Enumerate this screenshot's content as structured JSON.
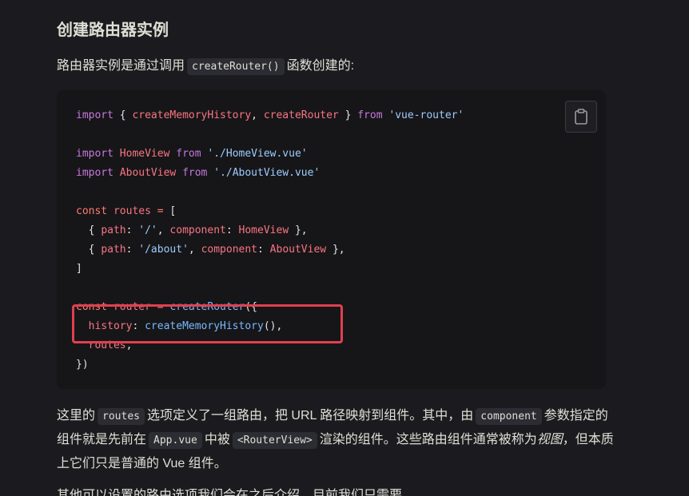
{
  "section": {
    "title": "创建路由器实例"
  },
  "intro": {
    "before": "路由器实例是通过调用",
    "code": "createRouter()",
    "after": "函数创建的:"
  },
  "code_block": {
    "copy_icon": "clipboard-icon",
    "lines": [
      [
        [
          "kw",
          "import"
        ],
        [
          "plain",
          " { "
        ],
        [
          "id",
          "createMemoryHistory"
        ],
        [
          "plain",
          ", "
        ],
        [
          "id",
          "createRouter"
        ],
        [
          "plain",
          " } "
        ],
        [
          "kw",
          "from"
        ],
        [
          "plain",
          " "
        ],
        [
          "str",
          "'vue-router'"
        ]
      ],
      [],
      [
        [
          "kw",
          "import"
        ],
        [
          "plain",
          " "
        ],
        [
          "id",
          "HomeView"
        ],
        [
          "plain",
          " "
        ],
        [
          "kw",
          "from"
        ],
        [
          "plain",
          " "
        ],
        [
          "str",
          "'./HomeView.vue'"
        ]
      ],
      [
        [
          "kw",
          "import"
        ],
        [
          "plain",
          " "
        ],
        [
          "id",
          "AboutView"
        ],
        [
          "plain",
          " "
        ],
        [
          "kw",
          "from"
        ],
        [
          "plain",
          " "
        ],
        [
          "str",
          "'./AboutView.vue'"
        ]
      ],
      [],
      [
        [
          "kw2",
          "const"
        ],
        [
          "plain",
          " "
        ],
        [
          "id",
          "routes"
        ],
        [
          "plain",
          " "
        ],
        [
          "kw2",
          "="
        ],
        [
          "plain",
          " ["
        ]
      ],
      [
        [
          "plain",
          "  { "
        ],
        [
          "id",
          "path"
        ],
        [
          "plain",
          ": "
        ],
        [
          "str",
          "'/'"
        ],
        [
          "plain",
          ", "
        ],
        [
          "id",
          "component"
        ],
        [
          "plain",
          ": "
        ],
        [
          "id",
          "HomeView"
        ],
        [
          "plain",
          " },"
        ]
      ],
      [
        [
          "plain",
          "  { "
        ],
        [
          "id",
          "path"
        ],
        [
          "plain",
          ": "
        ],
        [
          "str",
          "'/about'"
        ],
        [
          "plain",
          ", "
        ],
        [
          "id",
          "component"
        ],
        [
          "plain",
          ": "
        ],
        [
          "id",
          "AboutView"
        ],
        [
          "plain",
          " },"
        ]
      ],
      [
        [
          "plain",
          "]"
        ]
      ],
      [],
      [
        [
          "kw2",
          "const"
        ],
        [
          "plain",
          " "
        ],
        [
          "id",
          "router"
        ],
        [
          "plain",
          " "
        ],
        [
          "kw2",
          "="
        ],
        [
          "plain",
          " "
        ],
        [
          "fn",
          "createRouter"
        ],
        [
          "plain",
          "({"
        ]
      ],
      [
        [
          "plain",
          "  "
        ],
        [
          "id",
          "history"
        ],
        [
          "plain",
          ": "
        ],
        [
          "fn",
          "createMemoryHistory"
        ],
        [
          "plain",
          "(),"
        ]
      ],
      [
        [
          "plain",
          "  "
        ],
        [
          "id",
          "routes"
        ],
        [
          "plain",
          ","
        ]
      ],
      [
        [
          "plain",
          "})"
        ]
      ]
    ]
  },
  "paragraph": {
    "t1": "这里的",
    "c1": "routes",
    "t2": "选项定义了一组路由，把 URL 路径映射到组件。其中，由",
    "c2": "component",
    "t3": "参数指定的组件就是先前在",
    "c3": "App.vue",
    "t4": "中被",
    "c4": "<RouterView>",
    "t5": "渲染的组件。这些路由组件通常被称为",
    "em": "视图",
    "t6": "，但本质上它们只是普通的 Vue 组件。"
  },
  "paragraph_cut": {
    "text": "其他可以设置的路由选项我们会在之后介绍，目前我们只需要"
  }
}
